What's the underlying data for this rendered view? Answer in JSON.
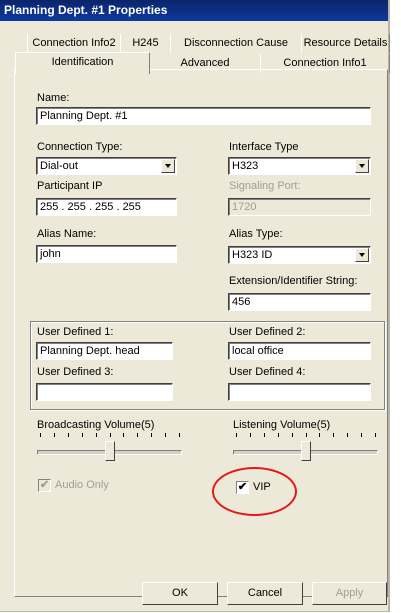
{
  "window": {
    "title": "Planning Dept. #1 Properties"
  },
  "tabs_back": [
    {
      "label": "Connection Info2"
    },
    {
      "label": "H245"
    },
    {
      "label": "Disconnection Cause"
    },
    {
      "label": "Resource Details"
    }
  ],
  "tabs_front": [
    {
      "label": "Identification",
      "selected": true
    },
    {
      "label": "Advanced"
    },
    {
      "label": "Connection Info1"
    }
  ],
  "name": {
    "label": "Name:",
    "value": "Planning Dept. #1"
  },
  "connection_type": {
    "label": "Connection Type:",
    "value": "Dial-out"
  },
  "interface_type": {
    "label": "Interface Type",
    "value": "H323"
  },
  "participant_ip": {
    "label": "Participant IP",
    "value": " 255 . 255 . 255 . 255"
  },
  "signaling_port": {
    "label": "Signaling Port:",
    "value": "1720"
  },
  "alias_name": {
    "label": "Alias Name:",
    "value": "john"
  },
  "alias_type": {
    "label": "Alias Type:",
    "value": "H323 ID"
  },
  "extension": {
    "label": "Extension/Identifier String:",
    "value": "456"
  },
  "user_defined": [
    {
      "label": "User Defined 1:",
      "value": "Planning Dept. head"
    },
    {
      "label": "User Defined 2:",
      "value": "local office"
    },
    {
      "label": "User Defined 3:",
      "value": ""
    },
    {
      "label": "User Defined 4:",
      "value": ""
    }
  ],
  "broadcasting_volume": {
    "label": "Broadcasting Volume(5)",
    "level": 5,
    "max": 10
  },
  "listening_volume": {
    "label": "Listening Volume(5)",
    "level": 5,
    "max": 10
  },
  "audio_only": {
    "label": "Audio Only",
    "checked": true,
    "enabled": false,
    "mark": "✔"
  },
  "vip": {
    "label": "VIP",
    "checked": true,
    "mark": "✔"
  },
  "buttons": {
    "ok": "OK",
    "cancel": "Cancel",
    "apply": "Apply"
  },
  "colors": {
    "title_bar": "#0a246a",
    "dialog": "#ece9d8",
    "highlight_circle": "#e4171b"
  }
}
